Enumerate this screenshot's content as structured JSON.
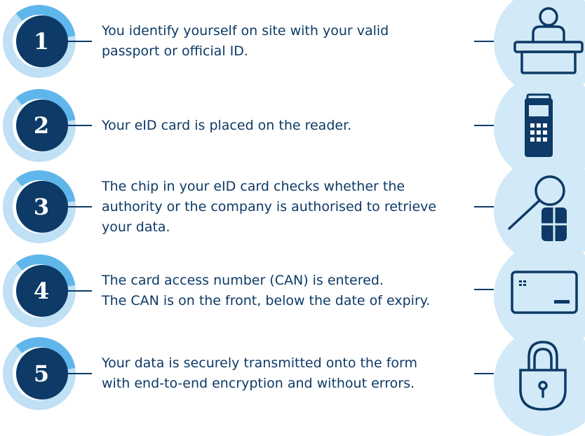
{
  "colors": {
    "navy": "#0d3a66",
    "ring_light": "#bfe0f5",
    "ring_mid": "#5fb6ea",
    "icon_bg": "#d2e9f7"
  },
  "steps": [
    {
      "number": "1",
      "text": "You identify yourself on site with your valid\npassport or official ID.",
      "icon": "reception-desk-person-icon"
    },
    {
      "number": "2",
      "text": "Your eID card is placed on the reader.",
      "icon": "card-reader-icon"
    },
    {
      "number": "3",
      "text": "The chip in your eID card checks whether the\nauthority or the company is authorised to retrieve\nyour data.",
      "icon": "magnifier-chip-icon"
    },
    {
      "number": "4",
      "text": "The card access number (CAN) is entered.\nThe CAN is on the front, below the date of expiry.",
      "icon": "id-card-icon"
    },
    {
      "number": "5",
      "text": "Your data is securely transmitted onto the form\nwith end-to-end encryption and without errors.",
      "icon": "padlock-icon"
    }
  ]
}
